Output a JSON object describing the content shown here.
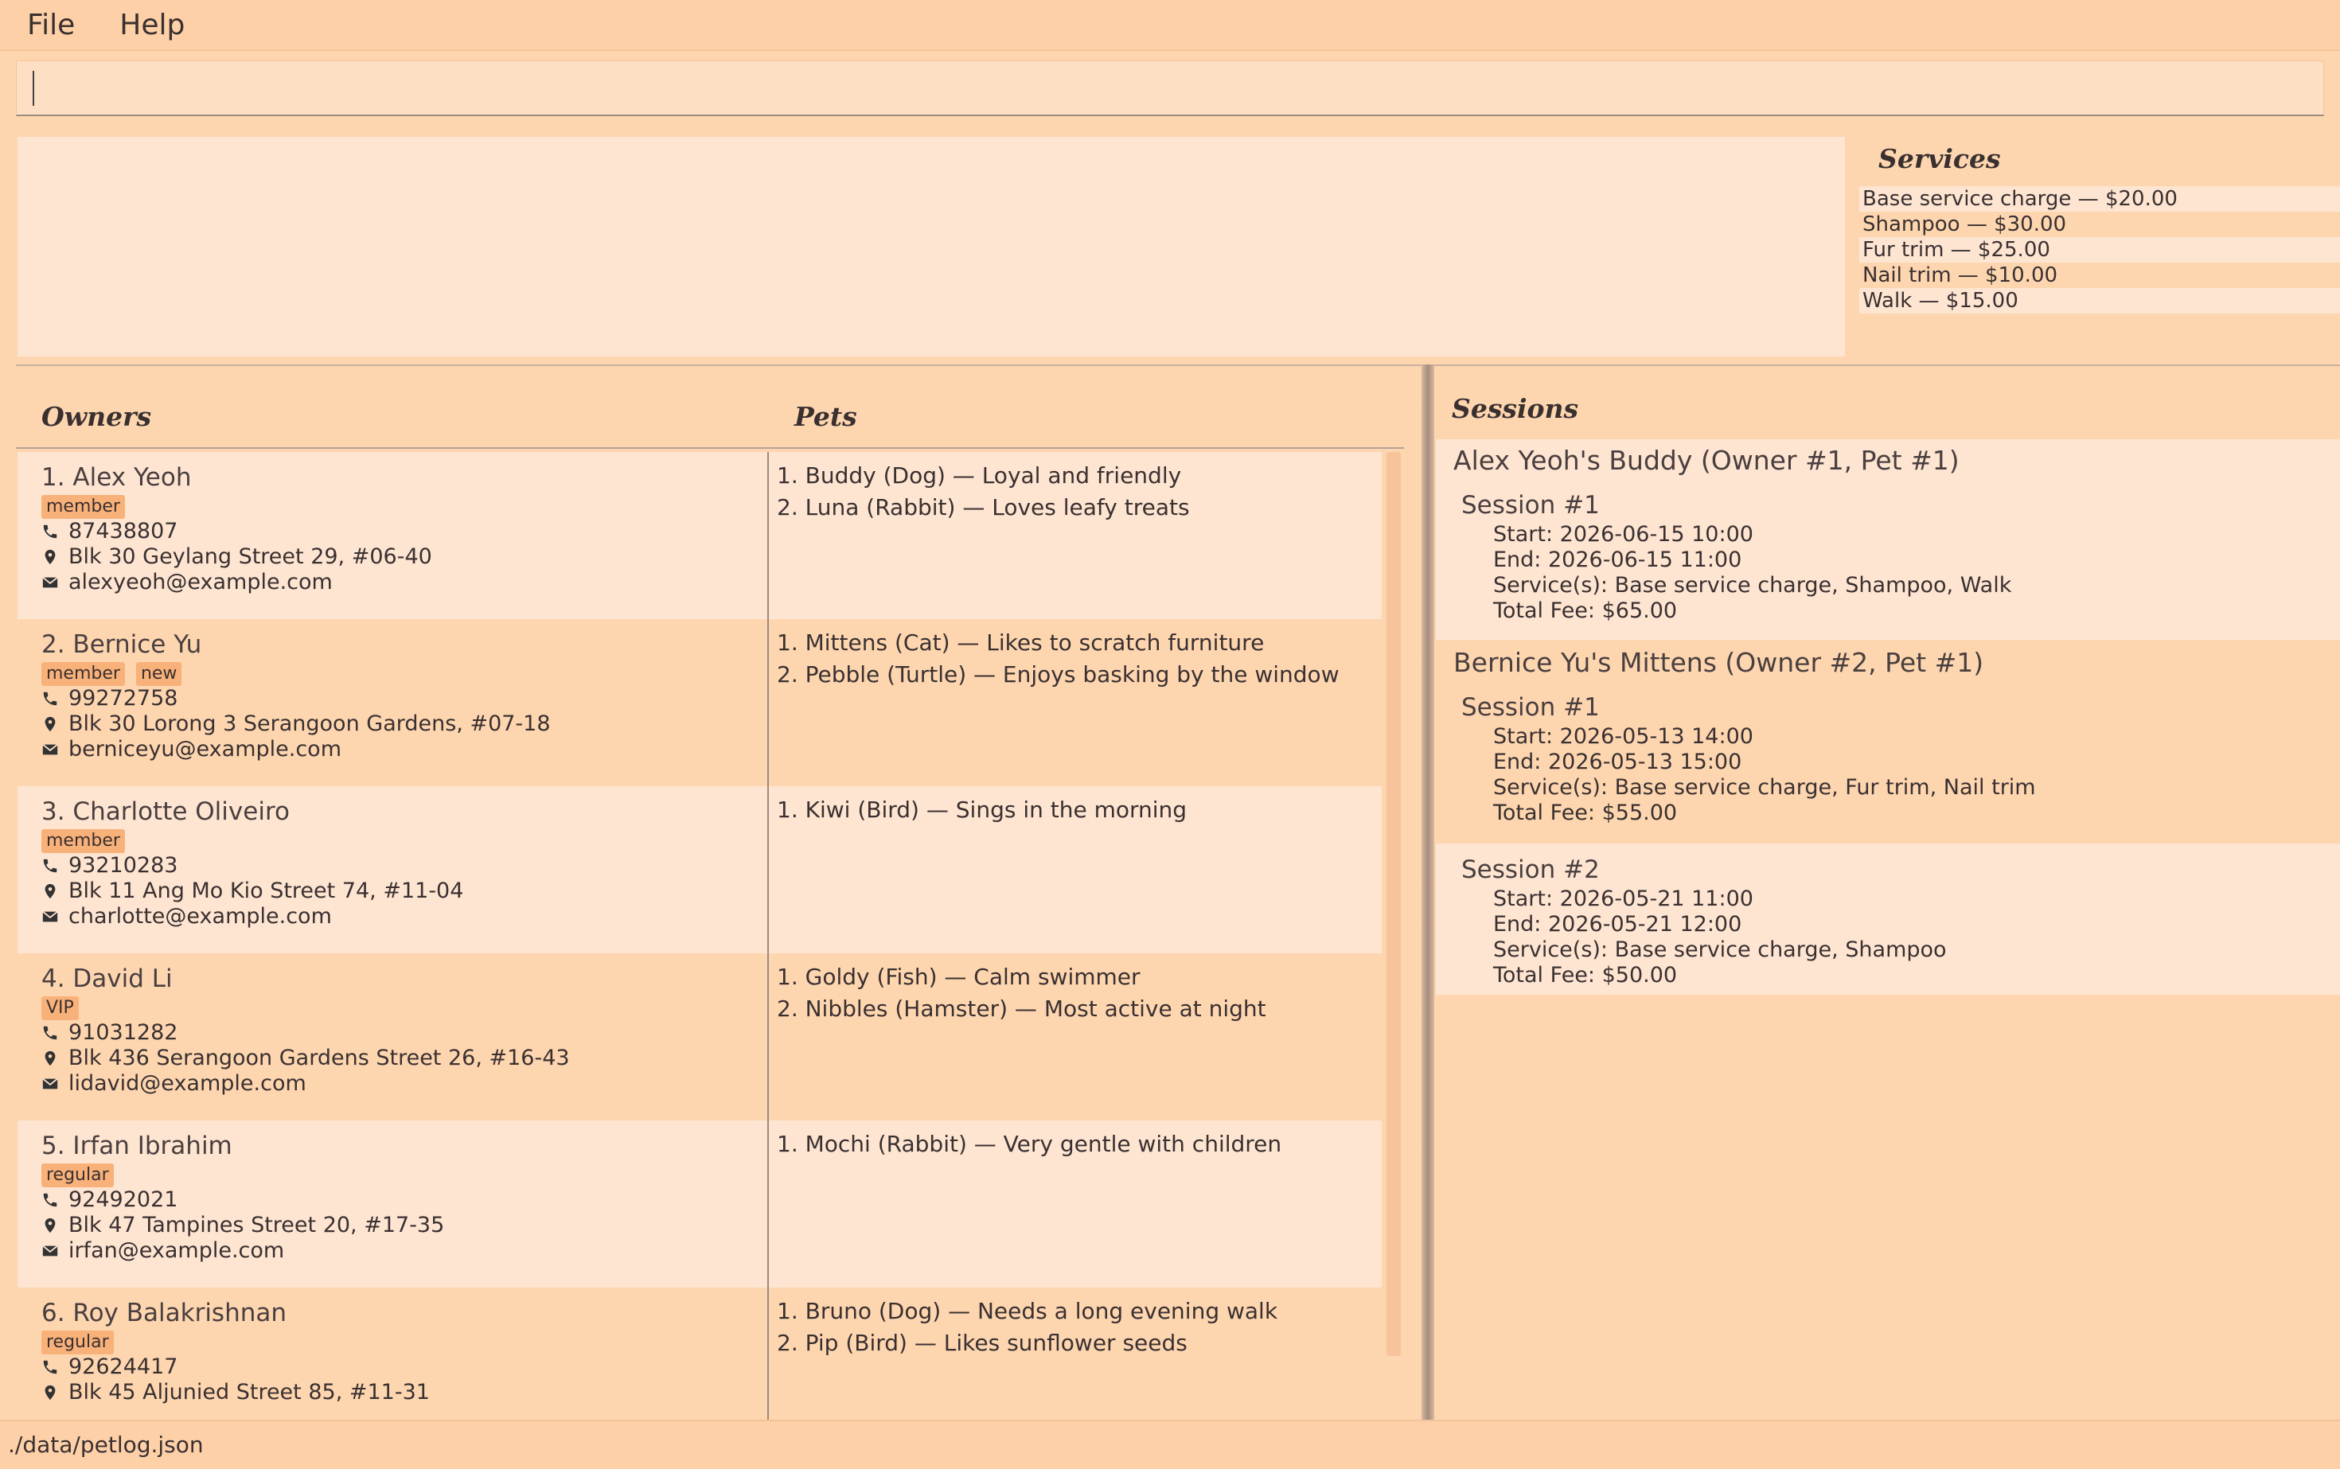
{
  "menu": {
    "file": "File",
    "help": "Help"
  },
  "command": {
    "value": "",
    "placeholder": ""
  },
  "services": {
    "title": "Services",
    "items": [
      "Base service charge — $20.00",
      "Shampoo — $30.00",
      "Fur trim — $25.00",
      "Nail trim — $10.00",
      "Walk — $15.00"
    ]
  },
  "owners_panel": {
    "owners_header": "Owners",
    "pets_header": "Pets",
    "rows": [
      {
        "name": "1. Alex Yeoh",
        "tags": [
          "member"
        ],
        "phone": "87438807",
        "address": "Blk 30 Geylang Street 29, #06-40",
        "email": "alexyeoh@example.com",
        "pets": [
          "1. Buddy (Dog) — Loyal and friendly",
          "2. Luna (Rabbit) — Loves leafy treats"
        ]
      },
      {
        "name": "2. Bernice Yu",
        "tags": [
          "member",
          "new"
        ],
        "phone": "99272758",
        "address": "Blk 30 Lorong 3 Serangoon Gardens, #07-18",
        "email": "berniceyu@example.com",
        "pets": [
          "1. Mittens (Cat) — Likes to scratch furniture",
          "2. Pebble (Turtle) — Enjoys basking by the window"
        ]
      },
      {
        "name": "3. Charlotte Oliveiro",
        "tags": [
          "member"
        ],
        "phone": "93210283",
        "address": "Blk 11 Ang Mo Kio Street 74, #11-04",
        "email": "charlotte@example.com",
        "pets": [
          "1. Kiwi (Bird) — Sings in the morning"
        ]
      },
      {
        "name": "4. David Li",
        "tags": [
          "VIP"
        ],
        "phone": "91031282",
        "address": "Blk 436 Serangoon Gardens Street 26, #16-43",
        "email": "lidavid@example.com",
        "pets": [
          "1. Goldy (Fish) — Calm swimmer",
          "2. Nibbles (Hamster) — Most active at night"
        ]
      },
      {
        "name": "5. Irfan Ibrahim",
        "tags": [
          "regular"
        ],
        "phone": "92492021",
        "address": "Blk 47 Tampines Street 20, #17-35",
        "email": "irfan@example.com",
        "pets": [
          "1. Mochi (Rabbit) — Very gentle with children"
        ]
      },
      {
        "name": "6. Roy Balakrishnan",
        "tags": [
          "regular"
        ],
        "phone": "92624417",
        "address": "Blk 45 Aljunied Street 85, #11-31",
        "email": "",
        "pets": [
          "1. Bruno (Dog) — Needs a long evening walk",
          "2. Pip (Bird) — Likes sunflower seeds"
        ]
      }
    ]
  },
  "sessions": {
    "title": "Sessions",
    "groups": [
      {
        "title": "Alex Yeoh's Buddy (Owner #1, Pet #1)",
        "sessions": [
          {
            "label": "Session #1",
            "start": "Start: 2026-06-15 10:00",
            "end": "End:   2026-06-15 11:00",
            "services": "Service(s): Base service charge, Shampoo, Walk",
            "fee": "Total Fee: $65.00"
          }
        ]
      },
      {
        "title": "Bernice Yu's Mittens (Owner #2, Pet #1)",
        "sessions": [
          {
            "label": "Session #1",
            "start": "Start: 2026-05-13 14:00",
            "end": "End:   2026-05-13 15:00",
            "services": "Service(s): Base service charge, Fur trim, Nail trim",
            "fee": "Total Fee: $55.00"
          },
          {
            "label": "Session #2",
            "start": "Start: 2026-05-21 11:00",
            "end": "End:   2026-05-21 12:00",
            "services": "Service(s): Base service charge, Shampoo",
            "fee": "Total Fee: $50.00"
          }
        ]
      }
    ]
  },
  "status": {
    "file_path": "./data/petlog.json"
  },
  "icons": {
    "phone": "phone-icon",
    "address": "map-pin-icon",
    "email": "envelope-icon"
  }
}
